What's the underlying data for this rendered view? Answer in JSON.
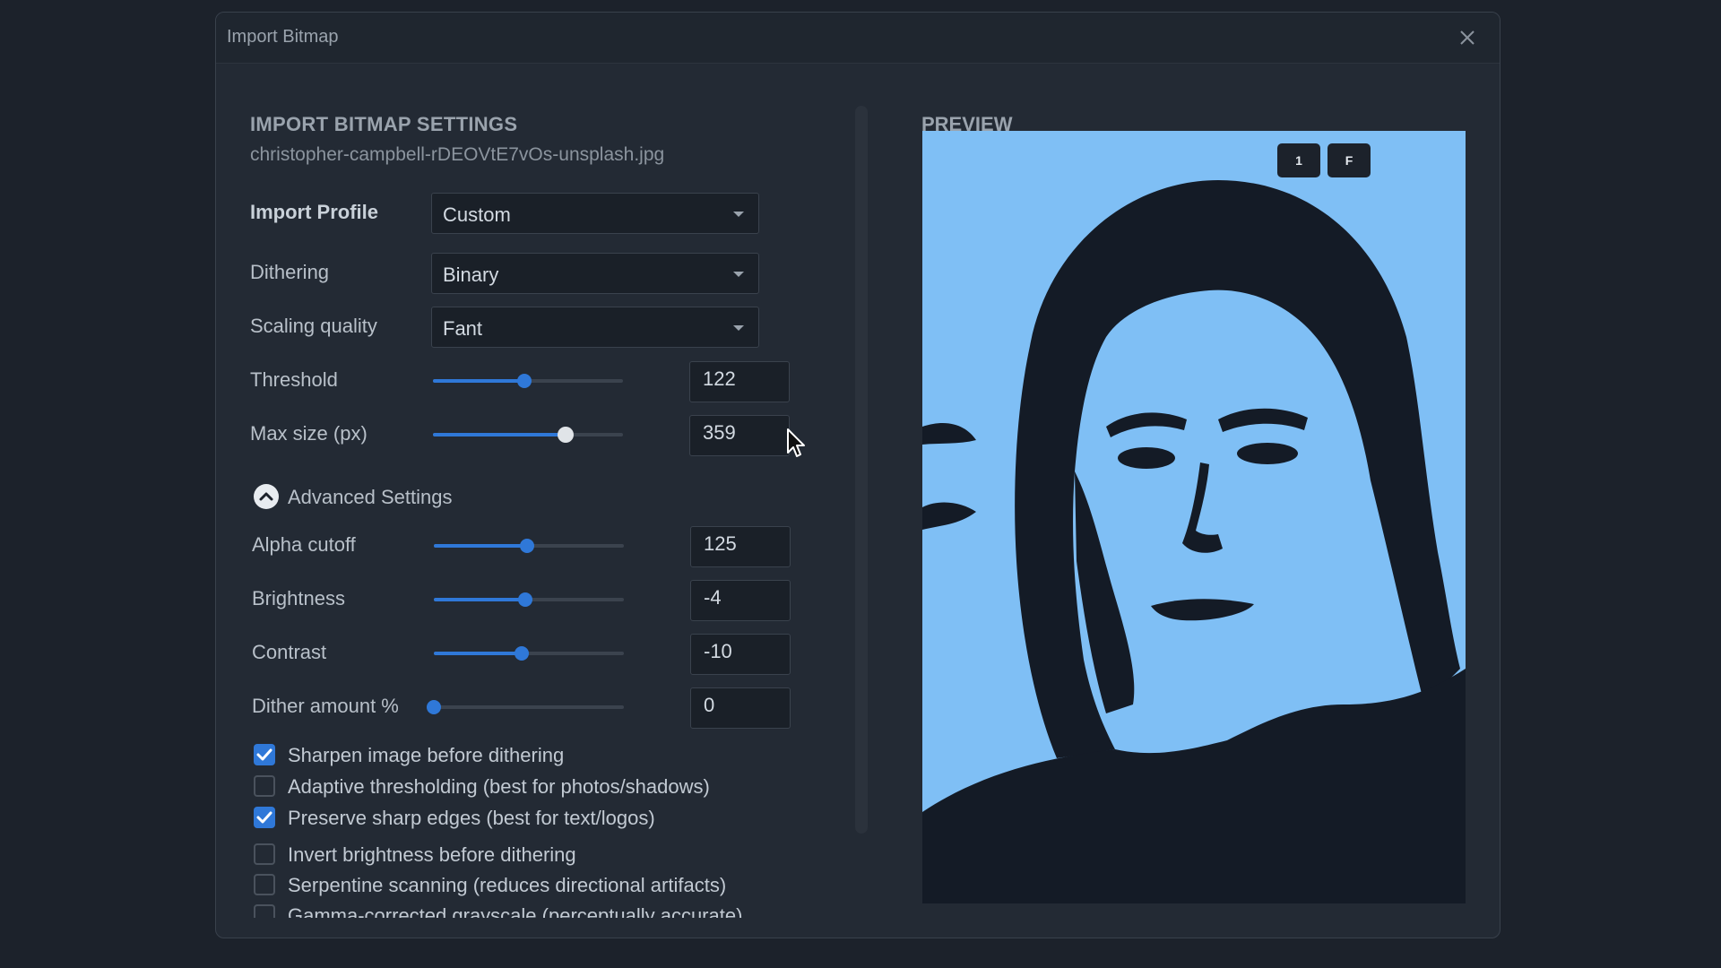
{
  "window": {
    "title": "Import Bitmap"
  },
  "settings": {
    "section_title": "IMPORT BITMAP SETTINGS",
    "filename": "christopher-campbell-rDEOVtE7vOs-unsplash.jpg",
    "import_profile": {
      "label": "Import Profile",
      "value": "Custom"
    },
    "dithering": {
      "label": "Dithering",
      "value": "Binary"
    },
    "scaling_quality": {
      "label": "Scaling quality",
      "value": "Fant"
    },
    "threshold": {
      "label": "Threshold",
      "value": "122",
      "fraction": 0.48
    },
    "max_size": {
      "label": "Max size (px)",
      "value": "359",
      "fraction": 0.7
    },
    "advanced": {
      "label": "Advanced Settings",
      "expanded": true,
      "alpha_cutoff": {
        "label": "Alpha cutoff",
        "value": "125",
        "fraction": 0.49
      },
      "brightness": {
        "label": "Brightness",
        "value": "-4",
        "fraction": 0.48
      },
      "contrast": {
        "label": "Contrast",
        "value": "-10",
        "fraction": 0.46
      },
      "dither_amount": {
        "label": "Dither amount %",
        "value": "0",
        "fraction": 0.0
      }
    },
    "options": [
      {
        "label": "Sharpen image before dithering",
        "checked": true
      },
      {
        "label": "Adaptive thresholding (best for photos/shadows)",
        "checked": false
      },
      {
        "label": "Preserve sharp edges (best for text/logos)",
        "checked": true
      },
      {
        "label": "Invert brightness before dithering",
        "checked": false
      },
      {
        "label": "Serpentine scanning (reduces directional artifacts)",
        "checked": false
      },
      {
        "label": "Gamma-corrected grayscale (perceptually accurate)",
        "checked": false
      }
    ]
  },
  "preview": {
    "title": "PREVIEW",
    "btn_1": "1",
    "btn_f": "F",
    "bg_color": "#7fbff5",
    "ink_color": "#141b26"
  },
  "colors": {
    "accent": "#2f78d8"
  }
}
